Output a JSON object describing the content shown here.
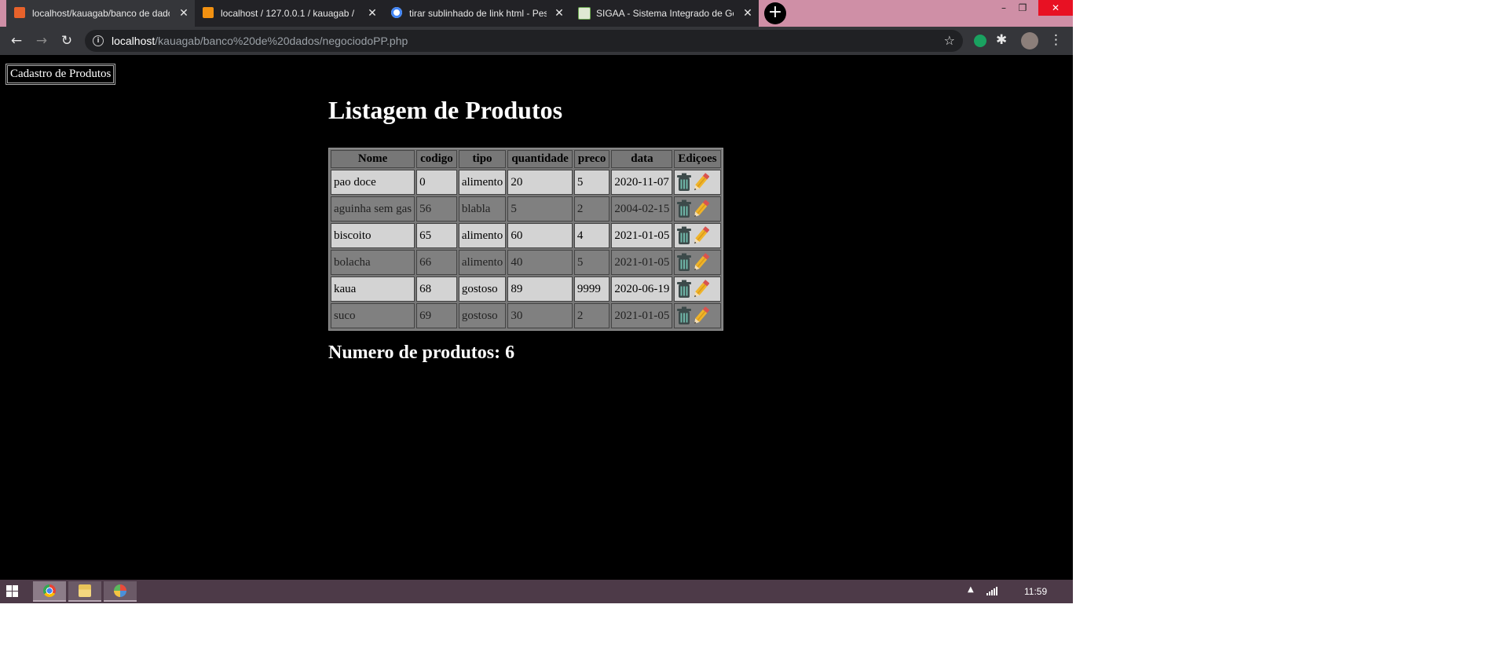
{
  "browser": {
    "tabs": [
      {
        "title": "localhost/kauagab/banco de dados",
        "active": true,
        "favicon": "xampp-icon",
        "favicon_color": "#e8622b"
      },
      {
        "title": "localhost / 127.0.0.1 / kauagab / ",
        "active": false,
        "favicon": "phpmyadmin-icon",
        "favicon_color": "#f29111"
      },
      {
        "title": "tirar sublinhado de link html - Pesquisa Google",
        "active": false,
        "favicon": "google-icon",
        "favicon_color": "#4285f4"
      },
      {
        "title": "SIGAA - Sistema Integrado de Gestão",
        "active": false,
        "favicon": "sigaa-icon",
        "favicon_color": "#6aa84f"
      }
    ],
    "tab_close_glyph": "✕",
    "new_tab_glyph": "+",
    "window_controls": {
      "minimize": "–",
      "maximize": "❐",
      "close": "✕"
    },
    "nav": {
      "back": "←",
      "forward": "→",
      "reload": "↻"
    },
    "url_host": "localhost",
    "url_path": "/kauagab/banco%20de%20dados/negociodoPP.php",
    "info_glyph": "i",
    "bookmark_glyph": "☆",
    "extensions_glyph": "✱",
    "menu_glyph": "⋮"
  },
  "page": {
    "nav_link": "Cadastro de Produtos",
    "title": "Listagem de Produtos",
    "count_text": "Numero de produtos: 6",
    "colors": {
      "background": "#000000",
      "row_light": "#d3d3d3",
      "row_dark": "#808080",
      "header": "#777777"
    }
  },
  "table": {
    "headers": [
      "Nome",
      "codigo",
      "tipo",
      "quantidade",
      "preco",
      "data",
      "Ediçoes"
    ],
    "rows": [
      [
        "pao doce",
        "0",
        "alimento",
        "20",
        "5",
        "2020-11-07"
      ],
      [
        "aguinha sem gas",
        "56",
        "blabla",
        "5",
        "2",
        "2004-02-15"
      ],
      [
        "biscoito",
        "65",
        "alimento",
        "60",
        "4",
        "2021-01-05"
      ],
      [
        "bolacha",
        "66",
        "alimento",
        "40",
        "5",
        "2021-01-05"
      ],
      [
        "kaua",
        "68",
        "gostoso",
        "89",
        "9999",
        "2020-06-19"
      ],
      [
        "suco",
        "69",
        "gostoso",
        "30",
        "2",
        "2021-01-05"
      ]
    ],
    "action_icons": [
      "trash-icon",
      "pencil-icon"
    ]
  },
  "taskbar": {
    "apps": [
      "chrome-icon",
      "file-explorer-icon",
      "paint-icon"
    ],
    "tray_arrow": "▲",
    "clock": "11:59"
  }
}
